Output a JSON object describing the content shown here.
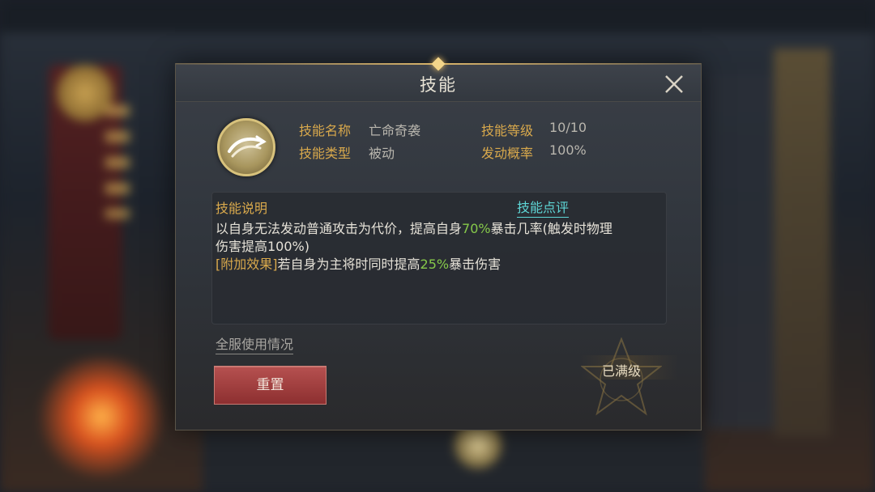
{
  "dialog": {
    "title": "技能",
    "skill": {
      "name_label": "技能名称",
      "name_value": "亡命奇袭",
      "level_label": "技能等级",
      "level_value": "10/10",
      "type_label": "技能类型",
      "type_value": "被动",
      "chance_label": "发动概率",
      "chance_value": "100%"
    },
    "description": {
      "title": "技能说明",
      "review_link": "技能点评",
      "line1_a": "以自身无法发动普通攻击为代价，提高自身",
      "line1_pct": "70%",
      "line1_b": "暴击几率(触发时物理",
      "line2": "伤害提高100%)",
      "line3_bracket": "[附加效果]",
      "line3_a": "若自身为主将时同时提高",
      "line3_pct": "25%",
      "line3_b": "暴击伤害"
    },
    "usage_link": "全服使用情况",
    "reset_button": "重置",
    "max_status": "已满级"
  }
}
